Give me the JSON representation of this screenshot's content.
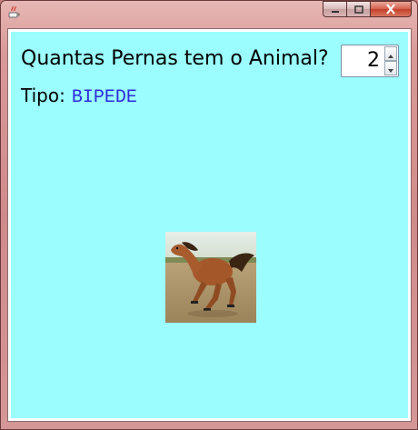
{
  "window": {
    "buttons": {
      "minimize_icon": "minimize-icon",
      "maximize_icon": "maximize-icon",
      "close_icon": "close-icon"
    }
  },
  "form": {
    "question": "Quantas Pernas tem o Animal?",
    "legs_value": "2",
    "type_label": "Tipo:",
    "type_value": "BIPEDE"
  },
  "image": {
    "icon": "horse-image"
  },
  "colors": {
    "background": "#9bfdfd",
    "type_value": "#2b2bdb"
  }
}
